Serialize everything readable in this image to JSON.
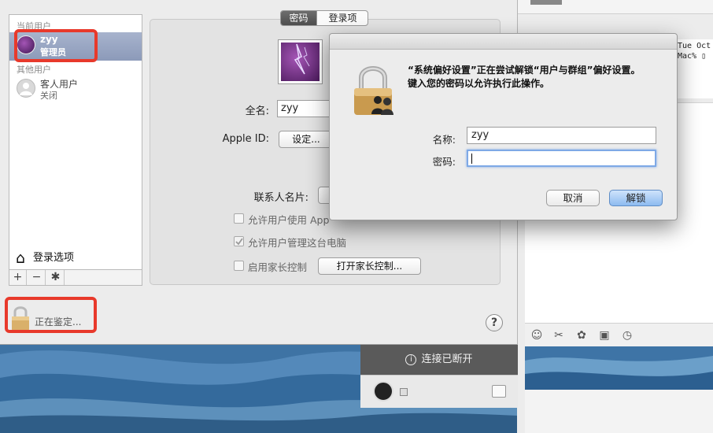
{
  "colors": {
    "highlight": "#e8392b",
    "selection": "#9aa6c3",
    "default_button": "#8dbbf0"
  },
  "sidebar": {
    "current_users_header": "当前用户",
    "current_user": {
      "name": "zyy",
      "role": "管理员"
    },
    "other_users_header": "其他用户",
    "guest_user": {
      "name": "客人用户",
      "status": "关闭"
    },
    "login_options": "登录选项",
    "buttons": {
      "add": "+",
      "remove": "−",
      "settings": "✱"
    }
  },
  "tabs": {
    "password": "密码",
    "login_items": "登录项"
  },
  "form": {
    "full_name_label": "全名:",
    "full_name_value": "zyy",
    "apple_id_label": "Apple ID:",
    "apple_id_button": "设定...",
    "contact_card_label": "联系人名片:",
    "allow_apple_id_label": "允许用户使用 Apple ID 重设密码",
    "allow_admin_label": "允许用户管理这台电脑",
    "parental_controls_label": "启用家长控制",
    "parental_controls_button": "打开家长控制..."
  },
  "lock_status": "正在鉴定...",
  "help": "?",
  "dialog": {
    "message_line1": "“系统偏好设置”正在尝试解锁“用户与群组”偏好设置。",
    "message_line2": "键入您的密码以允许执行此操作。",
    "name_label": "名称:",
    "name_value": "zyy",
    "password_label": "密码:",
    "password_value": "",
    "cancel": "取消",
    "unlock": "解锁"
  },
  "chat": {
    "terminal_line1": "Tue Oct",
    "terminal_line2": "Mac% ▯",
    "connection_status": "连接已断开",
    "toolbar_icons": [
      "smiley-icon",
      "scissors-icon",
      "sticker-icon",
      "image-icon",
      "clock-icon"
    ]
  }
}
